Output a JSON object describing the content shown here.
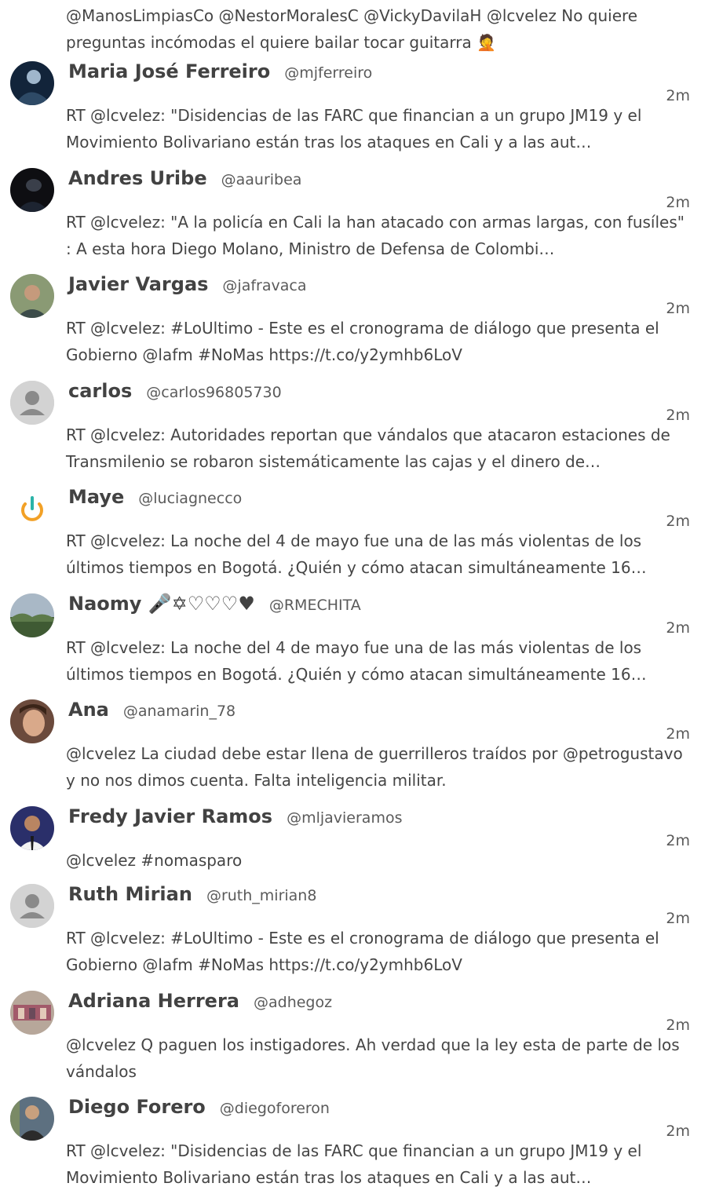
{
  "lead_text": "@ManosLimpiasCo @NestorMoralesC @VickyDavilaH @lcvelez No quiere preguntas incómodas el quiere bailar tocar guitarra 🤦",
  "tweets": [
    {
      "name": "Maria José Ferreiro",
      "handle": "@mjferreiro",
      "time": "2m",
      "text": "RT @lcvelez: \"Disidencias de las FARC que financian a un grupo JM19 y el Movimiento Bolivariano están tras los ataques en Cali y a las aut…",
      "avatar": "photo-avatar"
    },
    {
      "name": "Andres Uribe",
      "handle": "@aauribea",
      "time": "2m",
      "text": "RT @lcvelez: \"A la policía en Cali la han atacado con armas largas, con fusíles\" : A esta hora Diego Molano, Ministro de Defensa de Colombi…",
      "avatar": "photo-avatar"
    },
    {
      "name": "Javier Vargas",
      "handle": "@jafravaca",
      "time": "2m",
      "text": "RT @lcvelez: #LoUltimo - Este es el cronograma de diálogo que presenta el Gobierno @lafm #NoMas https://t.co/y2ymhb6LoV",
      "avatar": "photo-avatar"
    },
    {
      "name": "carlos",
      "handle": "@carlos96805730",
      "time": "2m",
      "text": "RT @lcvelez: Autoridades reportan que vándalos que atacaron estaciones de Transmilenio se robaron sistemáticamente las cajas y el dinero de…",
      "avatar": "default-user-avatar"
    },
    {
      "name": "Maye",
      "handle": "@luciagnecco",
      "time": "2m",
      "text": "RT @lcvelez: La noche del 4 de mayo fue una de las más violentas de los últimos tiempos en Bogotá. ¿Quién y cómo atacan simultáneamente 16…",
      "avatar": "power-logo-avatar"
    },
    {
      "name": "Naomy 🎤✡♡♡♡♥",
      "handle": "@RMECHITA",
      "time": "2m",
      "text": "RT @lcvelez: La noche del 4 de mayo fue una de las más violentas de los últimos tiempos en Bogotá. ¿Quién y cómo atacan simultáneamente 16…",
      "avatar": "landscape-avatar"
    },
    {
      "name": "Ana",
      "handle": "@anamarin_78",
      "time": "2m",
      "text": "@lcvelez La ciudad debe estar llena de guerrilleros traídos por @petrogustavo y no nos dimos cuenta. Falta inteligencia militar.",
      "avatar": "photo-avatar"
    },
    {
      "name": "Fredy Javier Ramos",
      "handle": "@mljavieramos",
      "time": "2m",
      "text": "@lcvelez #nomasparo",
      "avatar": "photo-avatar"
    },
    {
      "name": "Ruth Mirian",
      "handle": "@ruth_mirian8",
      "time": "2m",
      "text": "RT @lcvelez: #LoUltimo - Este es el cronograma de diálogo que presenta el Gobierno @lafm #NoMas https://t.co/y2ymhb6LoV",
      "avatar": "default-user-avatar"
    },
    {
      "name": "Adriana Herrera",
      "handle": "@adhegoz",
      "time": "2m",
      "text": "@lcvelez Q paguen los instigadores. Ah verdad que la ley esta de parte de los vándalos",
      "avatar": "photo-avatar"
    },
    {
      "name": "Diego Forero",
      "handle": "@diegoforeron",
      "time": "2m",
      "text": "RT @lcvelez: \"Disidencias de las FARC que financian a un grupo JM19 y el Movimiento Bolivariano están tras los ataques en Cali y a las aut…",
      "avatar": "photo-avatar"
    }
  ]
}
